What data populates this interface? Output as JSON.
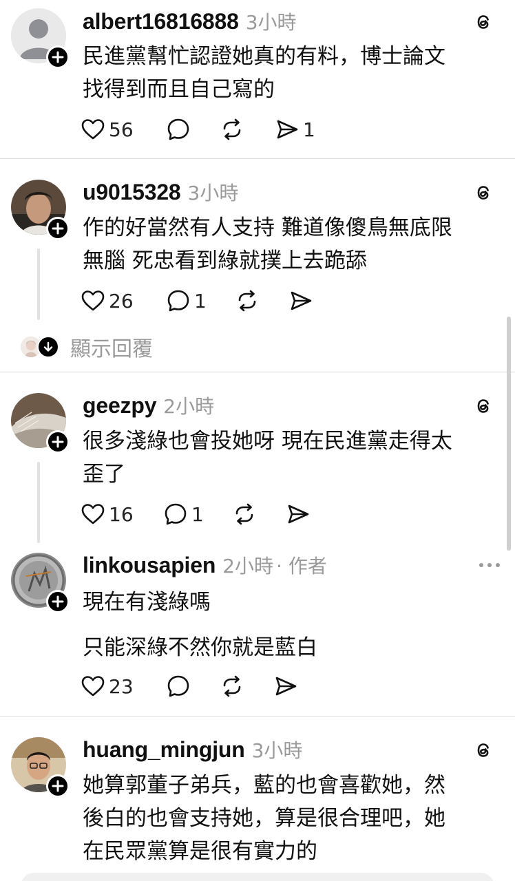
{
  "posts": [
    {
      "username": "albert16816888",
      "time": "3小時",
      "text": [
        "民進黨幫忙認證她真的有料，博士論文",
        "找得到而且自己寫的"
      ],
      "likes": "56",
      "comments": "",
      "reposts": "",
      "shares": "1"
    },
    {
      "username": "u9015328",
      "time": "3小時",
      "text": [
        "作的好當然有人支持 難道像傻鳥無底限",
        "無腦 死忠看到綠就撲上去跪舔"
      ],
      "likes": "26",
      "comments": "1",
      "reposts": "",
      "shares": ""
    },
    {
      "username": "geezpy",
      "time": "2小時",
      "text": [
        "很多淺綠也會投她呀 現在民進黨走得太",
        "歪了"
      ],
      "likes": "16",
      "comments": "1",
      "reposts": "",
      "shares": ""
    },
    {
      "username": "linkousapien",
      "time": "2小時",
      "author_tag": "· 作者",
      "text": [
        "現在有淺綠嗎",
        "只能深綠不然你就是藍白"
      ],
      "likes": "23",
      "comments": "",
      "reposts": "",
      "shares": ""
    },
    {
      "username": "huang_mingjun",
      "time": "3小時",
      "text": [
        "她算郭董子弟兵，藍的也會喜歡她，然",
        "後白的也會支持她，算是很合理吧，她",
        "在民眾黨算是很有實力的"
      ],
      "likes": "",
      "comments": "",
      "reposts": "",
      "shares": ""
    }
  ],
  "show_replies_label": "顯示回覆",
  "icons": {
    "threads": "threads-logo-icon",
    "like": "heart-icon",
    "comment": "comment-bubble-icon",
    "repost": "repost-icon",
    "share": "send-icon",
    "follow": "plus-icon",
    "more": "more-dots-icon"
  },
  "colors": {
    "text": "#111111",
    "muted": "#9a9a9a",
    "divider": "#dcdcdc",
    "badge": "#000000"
  }
}
